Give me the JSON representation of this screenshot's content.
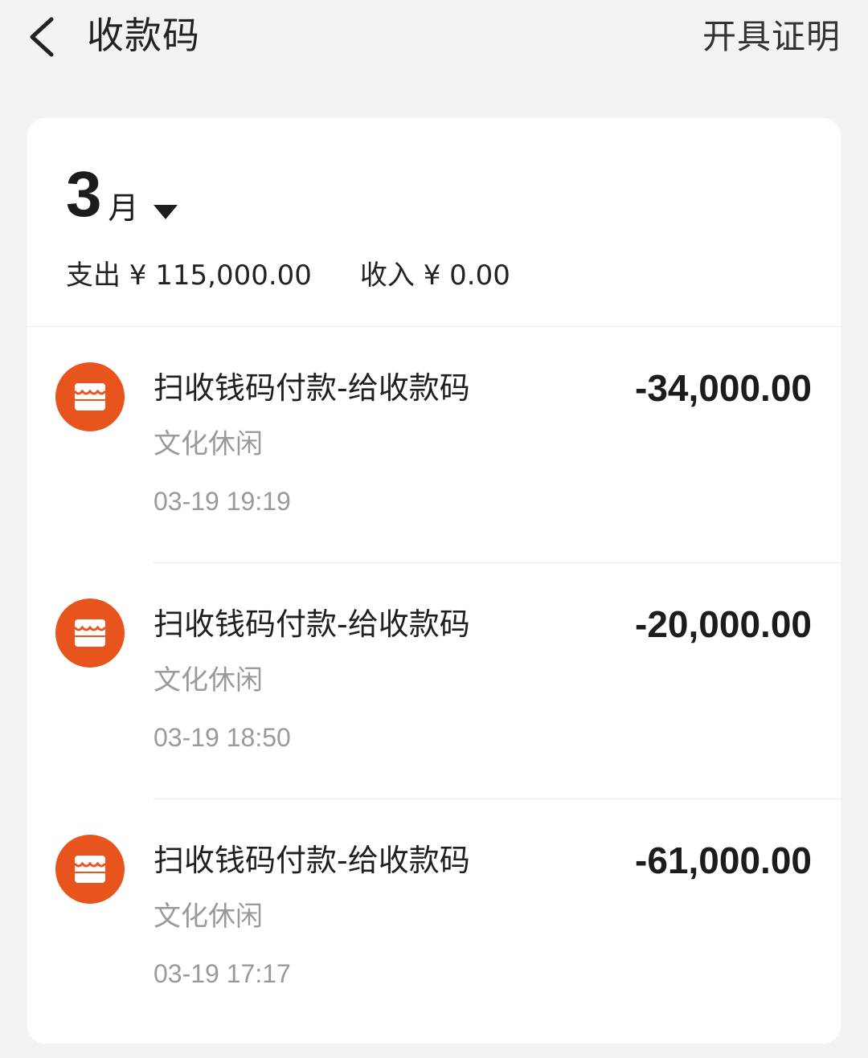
{
  "header": {
    "title": "收款码",
    "right_action": "开具证明",
    "back_icon": "chevron-left-icon"
  },
  "period": {
    "month_number": "3",
    "month_unit": "月",
    "dropdown_icon": "caret-down-icon"
  },
  "summary": {
    "expense": "支出 ¥ 115,000.00",
    "income": "收入 ¥ 0.00"
  },
  "colors": {
    "icon_orange": "#e8541d",
    "secondary_text": "#9a9a9a",
    "background": "#f3f3f3"
  },
  "transactions": [
    {
      "title": "扫收钱码付款-给收款码",
      "category": "文化休闲",
      "time": "03-19 19:19",
      "amount": "-34,000.00",
      "icon": "store-icon"
    },
    {
      "title": "扫收钱码付款-给收款码",
      "category": "文化休闲",
      "time": "03-19 18:50",
      "amount": "-20,000.00",
      "icon": "store-icon"
    },
    {
      "title": "扫收钱码付款-给收款码",
      "category": "文化休闲",
      "time": "03-19 17:17",
      "amount": "-61,000.00",
      "icon": "store-icon"
    }
  ]
}
